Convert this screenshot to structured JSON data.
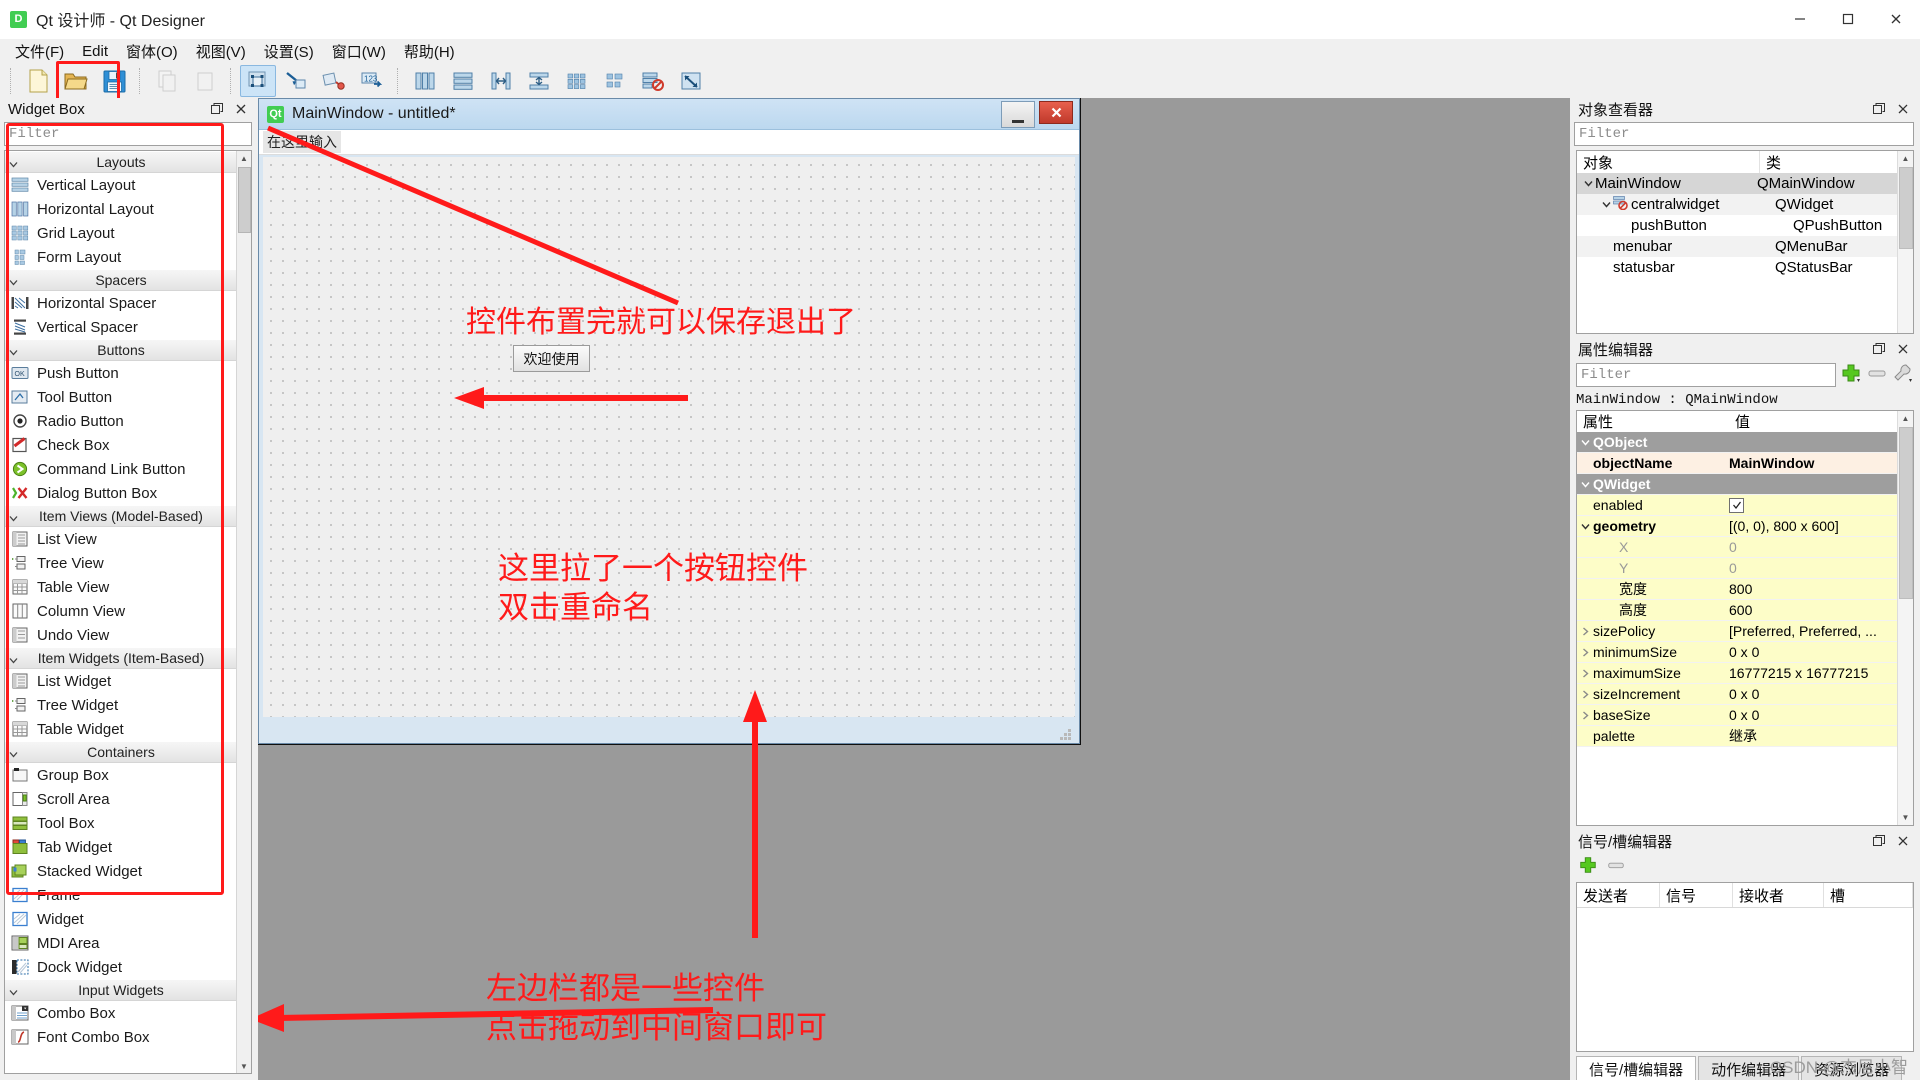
{
  "window": {
    "title": "Qt 设计师 - Qt Designer",
    "logo": "qt-logo",
    "minimize": "—",
    "maximize": "▢",
    "close": "✕"
  },
  "menubar": {
    "items": [
      {
        "label": "文件(F)"
      },
      {
        "label": "Edit"
      },
      {
        "label": "窗体(O)"
      },
      {
        "label": "视图(V)"
      },
      {
        "label": "设置(S)"
      },
      {
        "label": "窗口(W)"
      },
      {
        "label": "帮助(H)"
      }
    ]
  },
  "toolbar": {
    "buttons": [
      {
        "name": "new-form-icon",
        "title": "新建",
        "enabled": true
      },
      {
        "name": "open-form-icon",
        "title": "打开",
        "enabled": true
      },
      {
        "name": "save-form-icon",
        "title": "保存",
        "enabled": true,
        "highlighted": true
      },
      {
        "name": "copy-icon",
        "title": "复制",
        "enabled": false
      },
      {
        "name": "paste-icon",
        "title": "粘贴",
        "enabled": false
      },
      {
        "name": "edit-widgets-icon",
        "title": "编辑控件",
        "enabled": true,
        "active": true
      },
      {
        "name": "edit-signals-slots-icon",
        "title": "编辑信号/槽",
        "enabled": true
      },
      {
        "name": "edit-buddies-icon",
        "title": "编辑伙伴关系",
        "enabled": true
      },
      {
        "name": "edit-tab-order-icon",
        "title": "编辑Tab顺序",
        "enabled": true
      },
      {
        "name": "layout-horizontal-icon",
        "title": "水平布局",
        "enabled": true
      },
      {
        "name": "layout-vertical-icon",
        "title": "垂直布局",
        "enabled": true
      },
      {
        "name": "layout-splitter-h-icon",
        "title": "水平分裂器布局",
        "enabled": true
      },
      {
        "name": "layout-splitter-v-icon",
        "title": "垂直分裂器布局",
        "enabled": true
      },
      {
        "name": "layout-grid-icon",
        "title": "栅格布局",
        "enabled": true
      },
      {
        "name": "layout-form-icon",
        "title": "表单布局",
        "enabled": true
      },
      {
        "name": "break-layout-icon",
        "title": "打散布局",
        "enabled": true
      },
      {
        "name": "adjust-size-icon",
        "title": "调整大小",
        "enabled": true
      }
    ]
  },
  "widget_box": {
    "title": "Widget Box",
    "filter_placeholder": "Filter",
    "float_icon": "restore-icon",
    "close_icon": "close-icon",
    "groups": [
      {
        "label": "Layouts",
        "items": [
          {
            "label": "Vertical Layout",
            "icon": "vertical-layout-icon"
          },
          {
            "label": "Horizontal Layout",
            "icon": "horizontal-layout-icon"
          },
          {
            "label": "Grid Layout",
            "icon": "grid-layout-icon"
          },
          {
            "label": "Form Layout",
            "icon": "form-layout-icon"
          }
        ]
      },
      {
        "label": "Spacers",
        "items": [
          {
            "label": "Horizontal Spacer",
            "icon": "horizontal-spacer-icon"
          },
          {
            "label": "Vertical Spacer",
            "icon": "vertical-spacer-icon"
          }
        ]
      },
      {
        "label": "Buttons",
        "items": [
          {
            "label": "Push Button",
            "icon": "push-button-icon"
          },
          {
            "label": "Tool Button",
            "icon": "tool-button-icon"
          },
          {
            "label": "Radio Button",
            "icon": "radio-button-icon"
          },
          {
            "label": "Check Box",
            "icon": "check-box-icon"
          },
          {
            "label": "Command Link Button",
            "icon": "command-link-button-icon"
          },
          {
            "label": "Dialog Button Box",
            "icon": "dialog-button-box-icon"
          }
        ]
      },
      {
        "label": "Item Views (Model-Based)",
        "items": [
          {
            "label": "List View",
            "icon": "list-view-icon"
          },
          {
            "label": "Tree View",
            "icon": "tree-view-icon"
          },
          {
            "label": "Table View",
            "icon": "table-view-icon"
          },
          {
            "label": "Column View",
            "icon": "column-view-icon"
          },
          {
            "label": "Undo View",
            "icon": "undo-view-icon"
          }
        ]
      },
      {
        "label": "Item Widgets (Item-Based)",
        "items": [
          {
            "label": "List Widget",
            "icon": "list-widget-icon"
          },
          {
            "label": "Tree Widget",
            "icon": "tree-widget-icon"
          },
          {
            "label": "Table Widget",
            "icon": "table-widget-icon"
          }
        ]
      },
      {
        "label": "Containers",
        "items": [
          {
            "label": "Group Box",
            "icon": "group-box-icon"
          },
          {
            "label": "Scroll Area",
            "icon": "scroll-area-icon"
          },
          {
            "label": "Tool Box",
            "icon": "tool-box-icon"
          },
          {
            "label": "Tab Widget",
            "icon": "tab-widget-icon"
          },
          {
            "label": "Stacked Widget",
            "icon": "stacked-widget-icon"
          },
          {
            "label": "Frame",
            "icon": "frame-icon"
          },
          {
            "label": "Widget",
            "icon": "widget-icon"
          },
          {
            "label": "MDI Area",
            "icon": "mdi-area-icon"
          },
          {
            "label": "Dock Widget",
            "icon": "dock-widget-icon"
          }
        ]
      },
      {
        "label": "Input Widgets",
        "items": [
          {
            "label": "Combo Box",
            "icon": "combo-box-icon"
          },
          {
            "label": "Font Combo Box",
            "icon": "font-combo-box-icon"
          }
        ]
      }
    ]
  },
  "form": {
    "title": "MainWindow - untitled*",
    "menu_placeholder": "在这里输入",
    "minimize": "—",
    "close": "✕",
    "button": {
      "text": "欢迎使用"
    }
  },
  "annotations": [
    {
      "name": "annotation-save-exit",
      "text": "控件布置完就可以保存退出了"
    },
    {
      "name": "annotation-button-dragged",
      "text": "这里拉了一个按钮控件\n双击重命名"
    },
    {
      "name": "annotation-left-panel",
      "text": "左边栏都是一些控件\n点击拖动到中间窗口即可"
    }
  ],
  "object_inspector": {
    "title": "对象查看器",
    "filter_placeholder": "Filter",
    "columns": [
      "对象",
      "类"
    ],
    "rows": [
      {
        "object": "MainWindow",
        "class": "QMainWindow",
        "depth": 0,
        "expanded": true,
        "selected": true,
        "icon": ""
      },
      {
        "object": "centralwidget",
        "class": "QWidget",
        "depth": 1,
        "expanded": true,
        "selected": false,
        "icon": "no-layout-icon"
      },
      {
        "object": "pushButton",
        "class": "QPushButton",
        "depth": 2,
        "expanded": false,
        "selected": false,
        "icon": ""
      },
      {
        "object": "menubar",
        "class": "QMenuBar",
        "depth": 1,
        "expanded": false,
        "selected": false,
        "icon": ""
      },
      {
        "object": "statusbar",
        "class": "QStatusBar",
        "depth": 1,
        "expanded": false,
        "selected": false,
        "icon": ""
      }
    ]
  },
  "property_editor": {
    "title": "属性编辑器",
    "filter_placeholder": "Filter",
    "add_icon": "plus-icon",
    "remove_icon": "minus-icon",
    "config_icon": "wrench-icon",
    "object_line": "MainWindow : QMainWindow",
    "columns": [
      "属性",
      "值"
    ],
    "rows": [
      {
        "key": "QObject",
        "value": "",
        "type": "group",
        "expander": "v"
      },
      {
        "key": "objectName",
        "value": "MainWindow",
        "type": "objname",
        "indent": 1
      },
      {
        "key": "QWidget",
        "value": "",
        "type": "group",
        "expander": "v"
      },
      {
        "key": "enabled",
        "value": "",
        "type": "checkbox",
        "checked": true,
        "indent": 1
      },
      {
        "key": "geometry",
        "value": "[(0, 0), 800 x 600]",
        "type": "bold",
        "expander": "v",
        "indent": 0
      },
      {
        "key": "X",
        "value": "0",
        "type": "sub",
        "indent": 2
      },
      {
        "key": "Y",
        "value": "0",
        "type": "sub",
        "indent": 2
      },
      {
        "key": "宽度",
        "value": "800",
        "type": "sub2",
        "indent": 2
      },
      {
        "key": "高度",
        "value": "600",
        "type": "sub2",
        "indent": 2
      },
      {
        "key": "sizePolicy",
        "value": "[Preferred, Preferred, ...",
        "type": "plain",
        "expander": ">",
        "indent": 0
      },
      {
        "key": "minimumSize",
        "value": "0 x 0",
        "type": "plain",
        "expander": ">",
        "indent": 0
      },
      {
        "key": "maximumSize",
        "value": "16777215 x 16777215",
        "type": "plain",
        "expander": ">",
        "indent": 0
      },
      {
        "key": "sizeIncrement",
        "value": "0 x 0",
        "type": "plain",
        "expander": ">",
        "indent": 0
      },
      {
        "key": "baseSize",
        "value": "0 x 0",
        "type": "plain",
        "expander": ">",
        "indent": 0
      },
      {
        "key": "palette",
        "value": "继承",
        "type": "plain",
        "expander": "",
        "indent": 1
      }
    ]
  },
  "signal_slot_editor": {
    "title": "信号/槽编辑器",
    "add_icon": "plus-icon",
    "remove_icon": "minus-icon",
    "columns": [
      "发送者",
      "信号",
      "接收者",
      "槽"
    ],
    "rows": [],
    "tabs": [
      {
        "label": "信号/槽编辑器",
        "selected": true
      },
      {
        "label": "动作编辑器",
        "selected": false
      },
      {
        "label": "资源浏览器",
        "selected": false
      }
    ]
  },
  "watermark": {
    "text": "CSDN @杰尼小智"
  },
  "colors": {
    "annotation_red": "#ff1a1a",
    "qt_green": "#41cd52",
    "canvas_grey": "#9a9a9a",
    "selection_grey": "#d6d6d6",
    "property_yellow": "#fdfdc8",
    "property_group": "#9e9e9e"
  }
}
